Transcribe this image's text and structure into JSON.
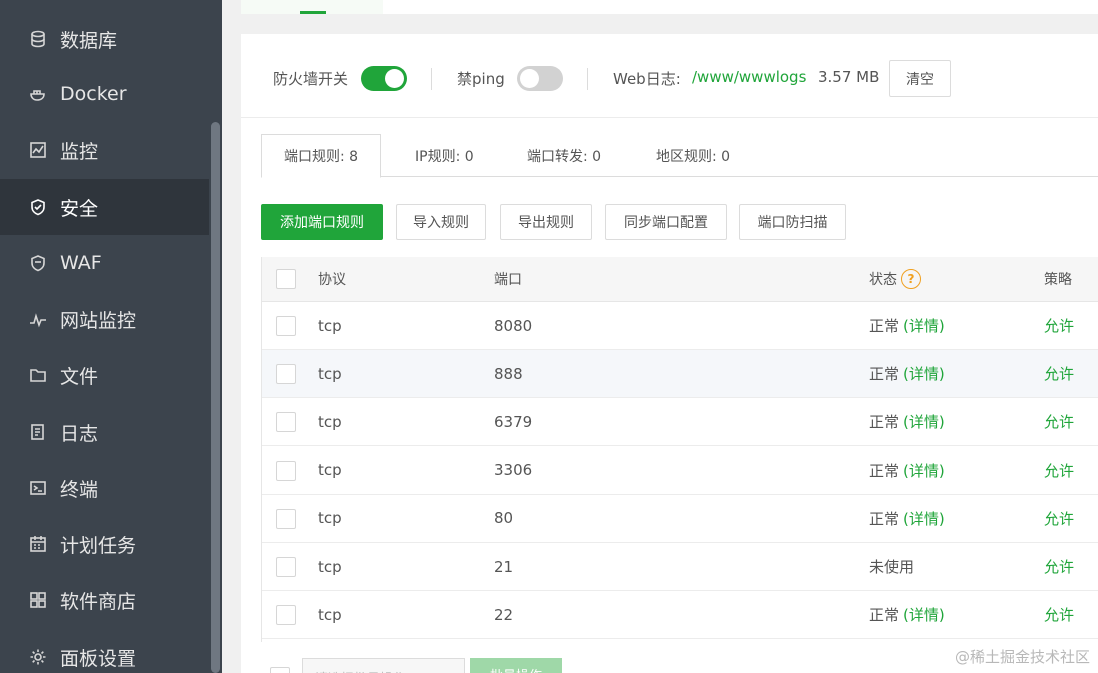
{
  "sidebar": {
    "items": [
      {
        "label": "数据库",
        "icon": "database-icon"
      },
      {
        "label": "Docker",
        "icon": "docker-icon"
      },
      {
        "label": "监控",
        "icon": "monitor-icon"
      },
      {
        "label": "安全",
        "icon": "shield-icon",
        "active": true
      },
      {
        "label": "WAF",
        "icon": "waf-shield-icon"
      },
      {
        "label": "网站监控",
        "icon": "pulse-icon"
      },
      {
        "label": "文件",
        "icon": "folder-icon"
      },
      {
        "label": "日志",
        "icon": "log-icon"
      },
      {
        "label": "终端",
        "icon": "terminal-icon"
      },
      {
        "label": "计划任务",
        "icon": "calendar-icon"
      },
      {
        "label": "软件商店",
        "icon": "apps-icon"
      },
      {
        "label": "面板设置",
        "icon": "gear-icon"
      }
    ]
  },
  "toolbar": {
    "firewall_label": "防火墙开关",
    "firewall_on": true,
    "ping_label": "禁ping",
    "ping_on": false,
    "weblog_label": "Web日志:",
    "weblog_path": "/www/wwwlogs",
    "weblog_size": "3.57 MB",
    "clear_label": "清空"
  },
  "tabs": [
    {
      "label": "端口规则: 8",
      "active": true
    },
    {
      "label": "IP规则: 0"
    },
    {
      "label": "端口转发: 0"
    },
    {
      "label": "地区规则: 0"
    }
  ],
  "actions": {
    "add": "添加端口规则",
    "import": "导入规则",
    "export": "导出规则",
    "sync": "同步端口配置",
    "scan": "端口防扫描"
  },
  "table": {
    "headers": {
      "protocol": "协议",
      "port": "端口",
      "status": "状态",
      "policy": "策略"
    },
    "help_glyph": "?",
    "detail_label": "(详情)",
    "rows": [
      {
        "protocol": "tcp",
        "port": "8080",
        "status": "正常",
        "detail": true,
        "policy": "允许"
      },
      {
        "protocol": "tcp",
        "port": "888",
        "status": "正常",
        "detail": true,
        "policy": "允许"
      },
      {
        "protocol": "tcp",
        "port": "6379",
        "status": "正常",
        "detail": true,
        "policy": "允许"
      },
      {
        "protocol": "tcp",
        "port": "3306",
        "status": "正常",
        "detail": true,
        "policy": "允许"
      },
      {
        "protocol": "tcp",
        "port": "80",
        "status": "正常",
        "detail": true,
        "policy": "允许"
      },
      {
        "protocol": "tcp",
        "port": "21",
        "status": "未使用",
        "detail": false,
        "policy": "允许"
      },
      {
        "protocol": "tcp",
        "port": "22",
        "status": "正常",
        "detail": true,
        "policy": "允许"
      }
    ]
  },
  "bottom": {
    "batch_select_placeholder": "请选择批量操作",
    "batch_button": "批量操作"
  },
  "watermark": "@稀土掘金技术社区",
  "colors": {
    "accent": "#20a53a",
    "sidebar_bg": "#3c444d",
    "sidebar_active": "#2f353c",
    "help": "#f0a020"
  }
}
